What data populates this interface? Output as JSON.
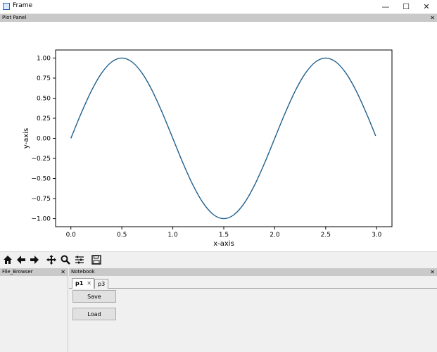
{
  "window": {
    "title": "Frame",
    "minimize_glyph": "—",
    "maximize_glyph": "☐",
    "close_glyph": "✕"
  },
  "plot_panel": {
    "caption": "Plot Panel",
    "close_glyph": "✕"
  },
  "chart_data": {
    "type": "line",
    "title": "",
    "xlabel": "x-axis",
    "ylabel": "y-axis",
    "xlim": [
      -0.15,
      3.15
    ],
    "ylim": [
      -1.1,
      1.1
    ],
    "xticks": [
      0.0,
      0.5,
      1.0,
      1.5,
      2.0,
      2.5,
      3.0
    ],
    "xtick_labels": [
      "0.0",
      "0.5",
      "1.0",
      "1.5",
      "2.0",
      "2.5",
      "3.0"
    ],
    "yticks": [
      1.0,
      0.75,
      0.5,
      0.25,
      0.0,
      -0.25,
      -0.5,
      -0.75,
      -1.0
    ],
    "ytick_labels": [
      "1.00",
      "0.75",
      "0.50",
      "0.25",
      "0.00",
      "−0.25",
      "−0.50",
      "−0.75",
      "−1.00"
    ],
    "grid": false,
    "line_color": "#1f5f8b",
    "series": [
      {
        "x": [
          0.0,
          0.1,
          0.2,
          0.3,
          0.4,
          0.5,
          0.6,
          0.7,
          0.8,
          0.9,
          1.0,
          1.1,
          1.2,
          1.3,
          1.4,
          1.5,
          1.6,
          1.7,
          1.8,
          1.9,
          2.0,
          2.1,
          2.2,
          2.3,
          2.4,
          2.5,
          2.6,
          2.7,
          2.8,
          2.9,
          2.99
        ],
        "y": [
          0.0,
          0.309,
          0.588,
          0.809,
          0.951,
          1.0,
          0.951,
          0.809,
          0.588,
          0.309,
          0.0,
          -0.309,
          -0.588,
          -0.809,
          -0.951,
          -1.0,
          -0.951,
          -0.809,
          -0.588,
          -0.309,
          0.0,
          0.309,
          0.588,
          0.809,
          0.951,
          1.0,
          0.951,
          0.809,
          0.588,
          0.309,
          0.031
        ]
      }
    ]
  },
  "toolbar": {
    "tools": [
      {
        "name": "home-icon"
      },
      {
        "name": "back-arrow-icon"
      },
      {
        "name": "forward-arrow-icon"
      },
      {
        "name": "pan-icon"
      },
      {
        "name": "zoom-icon"
      },
      {
        "name": "configure-subplots-icon"
      },
      {
        "name": "save-figure-icon"
      }
    ]
  },
  "file_browser": {
    "caption": "File_Browser",
    "close_glyph": "✕"
  },
  "notebook": {
    "caption": "Notebook",
    "close_glyph": "✕",
    "tabs": [
      {
        "label": "p1",
        "close_glyph": "✕"
      },
      {
        "label": "p3"
      }
    ],
    "save_label": "Save",
    "load_label": "Load"
  }
}
